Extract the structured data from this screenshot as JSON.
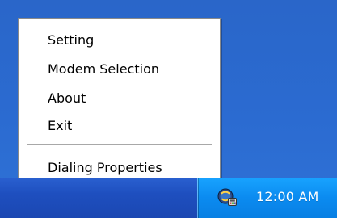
{
  "context_menu": {
    "items": [
      {
        "label": "Setting"
      },
      {
        "label": "Modem Selection"
      },
      {
        "label": "About"
      },
      {
        "label": "Exit"
      },
      {
        "label": "Dialing Properties"
      }
    ]
  },
  "system_tray": {
    "clock": "12:00 AM",
    "app_icon": "modem-dialer-icon"
  },
  "colors": {
    "desktop_blue": "#2b6bd1",
    "taskbar_blue": "#1f4fbf",
    "tray_blue": "#0b8bf0",
    "menu_bg": "#ffffff",
    "menu_border": "#8a8a8a"
  }
}
